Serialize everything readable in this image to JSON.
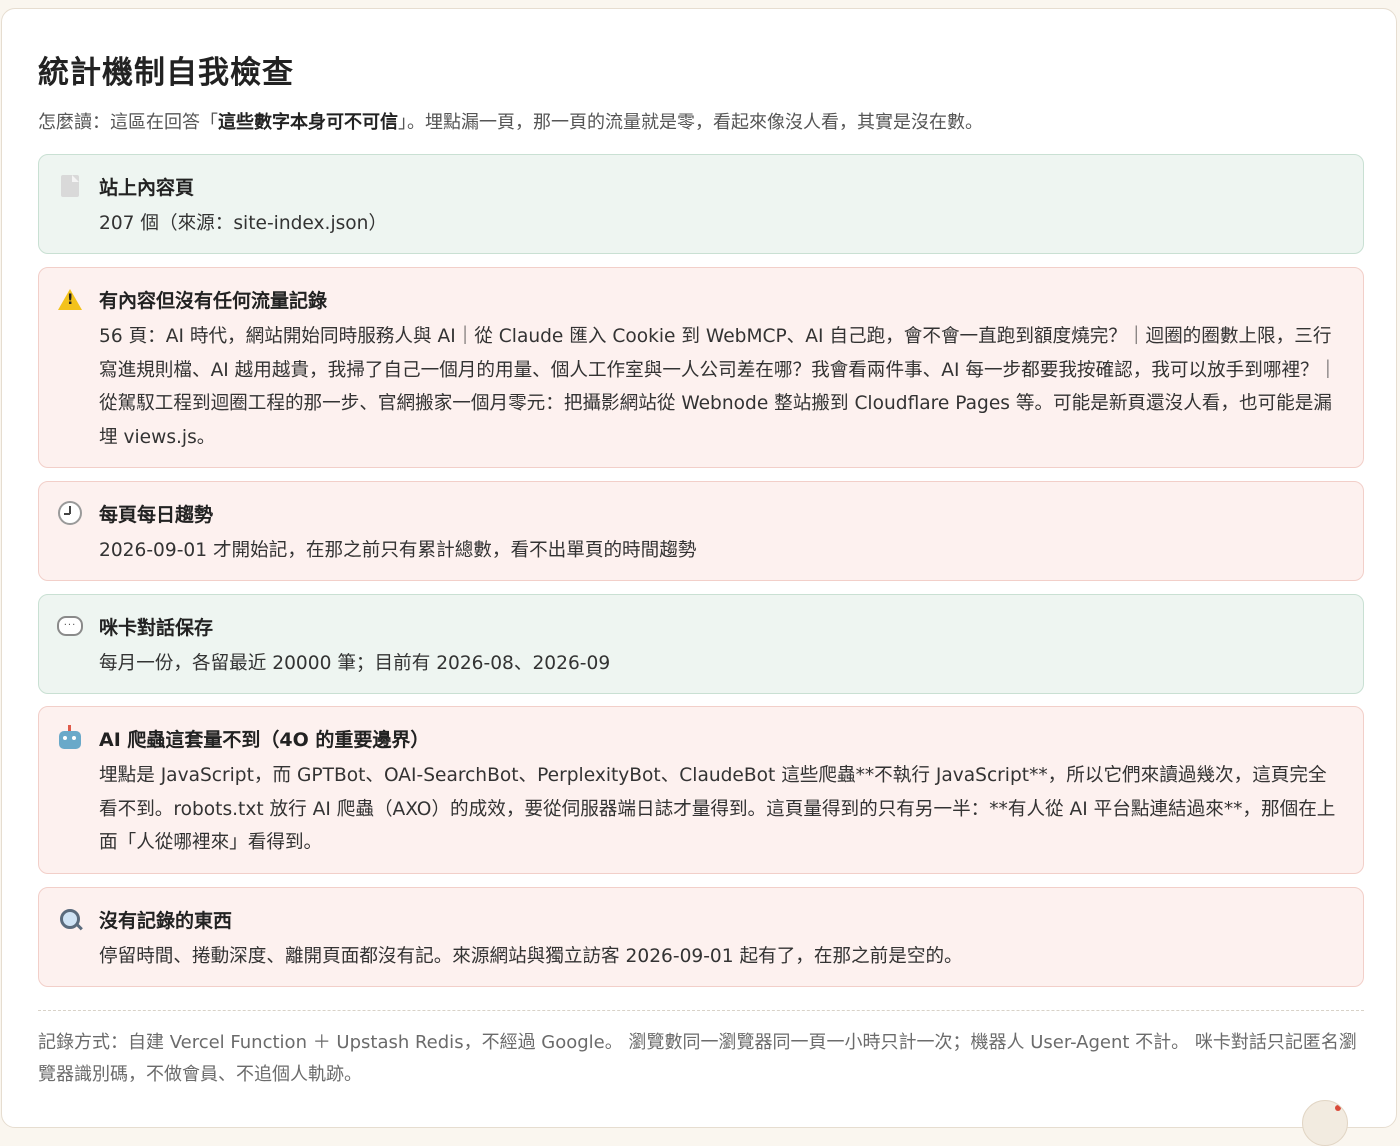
{
  "title": "統計機制自我檢查",
  "intro": {
    "prefix": "怎麼讀：這區在回答「",
    "emphasis": "這些數字本身可不可信",
    "suffix": "」。埋點漏一頁，那一頁的流量就是零，看起來像沒人看，其實是沒在數。"
  },
  "cards": [
    {
      "status": "ok",
      "icon": "document-icon",
      "heading": "站上內容頁",
      "body": "207 個（來源：site-index.json）"
    },
    {
      "status": "warn",
      "icon": "warning-icon",
      "heading": "有內容但沒有任何流量記錄",
      "body": "56 頁：AI 時代，網站開始同時服務人與 AI｜從 Claude 匯入 Cookie 到 WebMCP、AI 自己跑，會不會一直跑到額度燒完？｜迴圈的圈數上限，三行寫進規則檔、AI 越用越貴，我掃了自己一個月的用量、個人工作室與一人公司差在哪？我會看兩件事、AI 每一步都要我按確認，我可以放手到哪裡？｜從駕馭工程到迴圈工程的那一步、官網搬家一個月零元：把攝影網站從 Webnode 整站搬到 Cloudflare Pages 等。可能是新頁還沒人看，也可能是漏埋 views.js。"
    },
    {
      "status": "warn",
      "icon": "clock-icon",
      "heading": "每頁每日趨勢",
      "body": "2026-09-01 才開始記，在那之前只有累計總數，看不出單頁的時間趨勢"
    },
    {
      "status": "ok",
      "icon": "speech-bubble-icon",
      "heading": "咪卡對話保存",
      "body": "每月一份，各留最近 20000 筆；目前有 2026-08、2026-09"
    },
    {
      "status": "warn",
      "icon": "robot-icon",
      "heading": "AI 爬蟲這套量不到（4O 的重要邊界）",
      "body": "埋點是 JavaScript，而 GPTBot、OAI-SearchBot、PerplexityBot、ClaudeBot 這些爬蟲**不執行 JavaScript**，所以它們來讀過幾次，這頁完全看不到。robots.txt 放行 AI 爬蟲（AXO）的成效，要從伺服器端日誌才量得到。這頁量得到的只有另一半：**有人從 AI 平台點連結過來**，那個在上面「人從哪裡來」看得到。"
    },
    {
      "status": "warn",
      "icon": "magnifier-icon",
      "heading": "沒有記錄的東西",
      "body": "停留時間、捲動深度、離開頁面都沒有記。來源網站與獨立訪客 2026-09-01 起有了，在那之前是空的。"
    }
  ],
  "footer": "記錄方式：自建 Vercel Function ＋ Upstash Redis，不經過 Google。 瀏覽數同一瀏覽器同一頁一小時只計一次；機器人 User-Agent 不計。 咪卡對話只記匿名瀏覽器識別碼，不做會員、不追個人軌跡。",
  "colors": {
    "ok_bg": "#eef5f1",
    "ok_border": "#c9e0d3",
    "warn_bg": "#fdf1ef",
    "warn_border": "#f2cfc9"
  }
}
